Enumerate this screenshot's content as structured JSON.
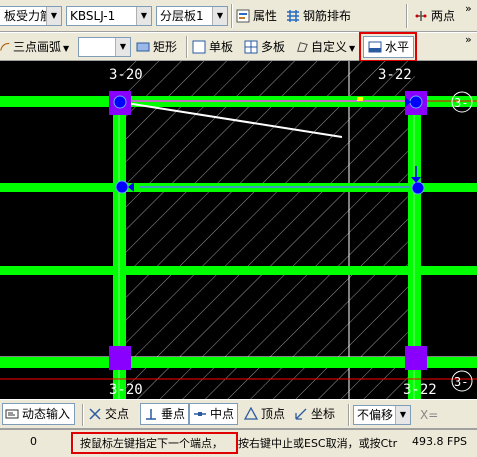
{
  "toolbar1": {
    "prev_combo": "板受力筋",
    "code_combo": "KBSLJ-1",
    "layer_combo": "分层板1",
    "attr_label": "属性",
    "rebar_layout_label": "钢筋排布",
    "twopoint_label": "两点",
    "overflow": "»"
  },
  "toolbar2": {
    "arc_label": "三点画弧",
    "rect_label": "矩形",
    "single_label": "单板",
    "multi_label": "多板",
    "custom_label": "自定义",
    "horizontal_label": "水平",
    "overflow": "»"
  },
  "canvas": {
    "axis_labels": [
      "3-20",
      "3-22",
      "3-20",
      "3-22",
      "3-",
      "3-"
    ],
    "colors": {
      "beam": "#00ff00",
      "column": "#8a00ff",
      "node": "#0000ff",
      "redline": "#ff0000",
      "background": "#000000",
      "hatch": "#ffffff"
    }
  },
  "toolbar3": {
    "dynamic_input": "动态输入",
    "intersection": "交点",
    "perpendicular": "垂点",
    "midpoint": "中点",
    "vertex": "顶点",
    "coordinate": "坐标",
    "offset_combo": "不偏移",
    "x_label": "X="
  },
  "status": {
    "value": "0",
    "prompt": "按鼠标左键指定下一个端点，",
    "hint": "按右键中止或ESC取消，或按Ctr",
    "fps": "493.8 FPS"
  }
}
